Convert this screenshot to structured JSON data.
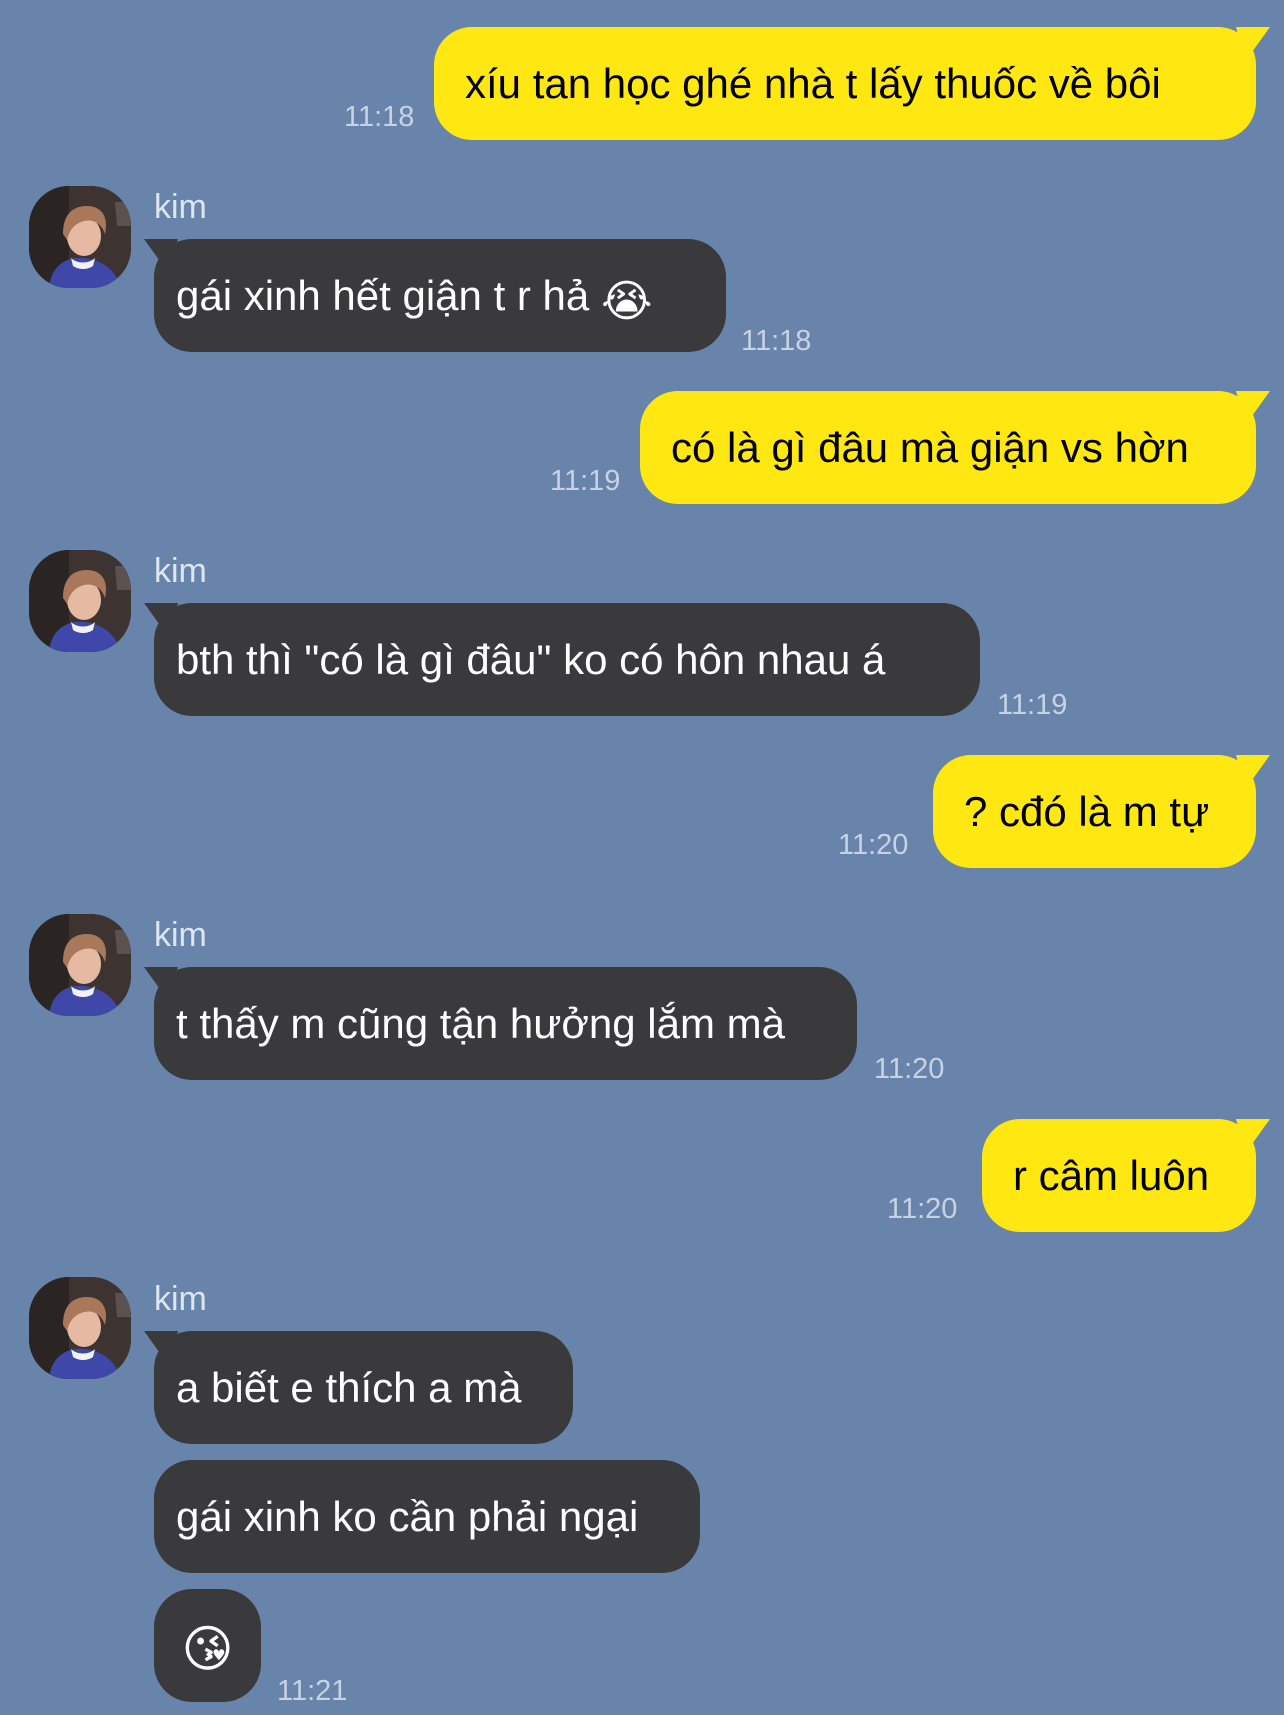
{
  "contact": {
    "name": "kim"
  },
  "colors": {
    "background": "#6884aa",
    "outgoing": "#ffe812",
    "incoming": "#3a3a3c"
  },
  "messages": [
    {
      "dir": "out",
      "text": "xíu tan học ghé nhà t lấy thuốc về bôi",
      "time": "11:18"
    },
    {
      "dir": "in",
      "sender": "kim",
      "text": "gái xinh hết giận t r hả",
      "emoji": "😭",
      "time": "11:18"
    },
    {
      "dir": "out",
      "text": "có là gì đâu mà giận vs hờn",
      "time": "11:19"
    },
    {
      "dir": "in",
      "sender": "kim",
      "text": "bth thì \"có là gì đâu\" ko có hôn nhau á",
      "time": "11:19"
    },
    {
      "dir": "out",
      "text": "? cđó là m tự",
      "time": "11:20"
    },
    {
      "dir": "in",
      "sender": "kim",
      "text": "t thấy m cũng tận hưởng lắm mà",
      "time": "11:20"
    },
    {
      "dir": "out",
      "text": "r câm luôn",
      "time": "11:20"
    },
    {
      "dir": "in",
      "sender": "kim",
      "text": "a biết e thích a mà"
    },
    {
      "dir": "in",
      "text": "gái xinh ko cần phải ngại"
    },
    {
      "dir": "in",
      "emoji": "😘",
      "time": "11:21"
    }
  ]
}
